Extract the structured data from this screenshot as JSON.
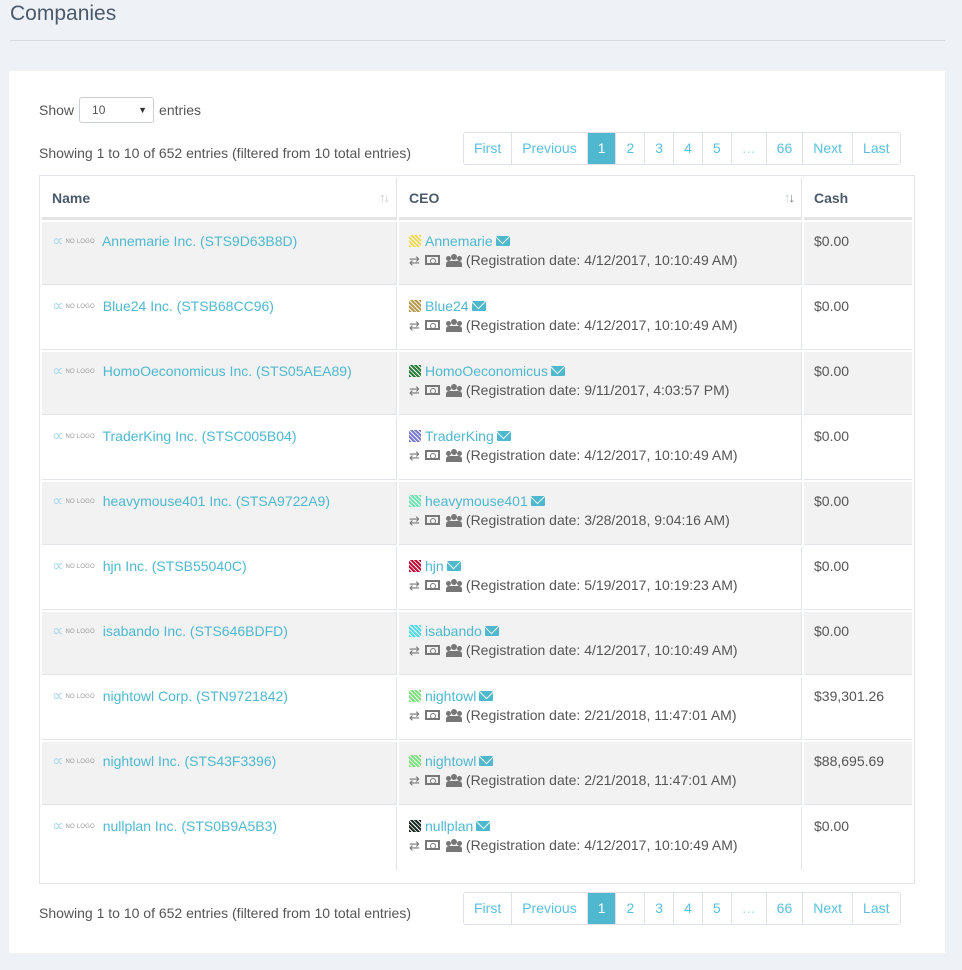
{
  "page": {
    "title": "Companies"
  },
  "length": {
    "show_label": "Show",
    "selected": "10",
    "entries_label": "entries"
  },
  "info": {
    "text": "Showing 1 to 10 of 652 entries (filtered from 10 total entries)"
  },
  "pagination": {
    "first": "First",
    "previous": "Previous",
    "pages": [
      "1",
      "2",
      "3",
      "4",
      "5",
      "…",
      "66"
    ],
    "active": "1",
    "next": "Next",
    "last": "Last"
  },
  "table": {
    "columns": [
      {
        "label": "Name",
        "sort": "unsorted"
      },
      {
        "label": "CEO",
        "sort": "descending"
      },
      {
        "label": "Cash",
        "sort": "none"
      }
    ],
    "nologo_label": "NO LOGO",
    "registration_prefix": "(Registration date: ",
    "registration_suffix": ")",
    "rows": [
      {
        "company": "Annemarie Inc. (STS9D63B8D)",
        "ceo": "Annemarie",
        "avatar_color": "#f0d860",
        "registration": "4/12/2017, 10:10:49 AM",
        "cash": "$0.00"
      },
      {
        "company": "Blue24 Inc. (STSB68CC96)",
        "ceo": "Blue24",
        "avatar_color": "#b89a50",
        "registration": "4/12/2017, 10:10:49 AM",
        "cash": "$0.00"
      },
      {
        "company": "HomoOeconomicus Inc. (STS05AEA89)",
        "ceo": "HomoOeconomicus",
        "avatar_color": "#2a7a3a",
        "registration": "9/11/2017, 4:03:57 PM",
        "cash": "$0.00"
      },
      {
        "company": "TraderKing Inc. (STSC005B04)",
        "ceo": "TraderKing",
        "avatar_color": "#7a7ad0",
        "registration": "4/12/2017, 10:10:49 AM",
        "cash": "$0.00"
      },
      {
        "company": "heavymouse401 Inc. (STSA9722A9)",
        "ceo": "heavymouse401",
        "avatar_color": "#70e0b0",
        "registration": "3/28/2018, 9:04:16 AM",
        "cash": "$0.00"
      },
      {
        "company": "hjn Inc. (STSB55040C)",
        "ceo": "hjn",
        "avatar_color": "#c0103a",
        "registration": "5/19/2017, 10:19:23 AM",
        "cash": "$0.00"
      },
      {
        "company": "isabando Inc. (STS646BDFD)",
        "ceo": "isabando",
        "avatar_color": "#50d8e8",
        "registration": "4/12/2017, 10:10:49 AM",
        "cash": "$0.00"
      },
      {
        "company": "nightowl Corp. (STN9721842)",
        "ceo": "nightowl",
        "avatar_color": "#80e080",
        "registration": "2/21/2018, 11:47:01 AM",
        "cash": "$39,301.26"
      },
      {
        "company": "nightowl Inc. (STS43F3396)",
        "ceo": "nightowl",
        "avatar_color": "#80e080",
        "registration": "2/21/2018, 11:47:01 AM",
        "cash": "$88,695.69"
      },
      {
        "company": "nullplan Inc. (STS0B9A5B3)",
        "ceo": "nullplan",
        "avatar_color": "#1a2a22",
        "registration": "4/12/2017, 10:10:49 AM",
        "cash": "$0.00"
      }
    ]
  },
  "colors": {
    "accent": "#4fb8cf",
    "page_bg": "#eef1f5",
    "stripe": "#f2f2f2"
  }
}
